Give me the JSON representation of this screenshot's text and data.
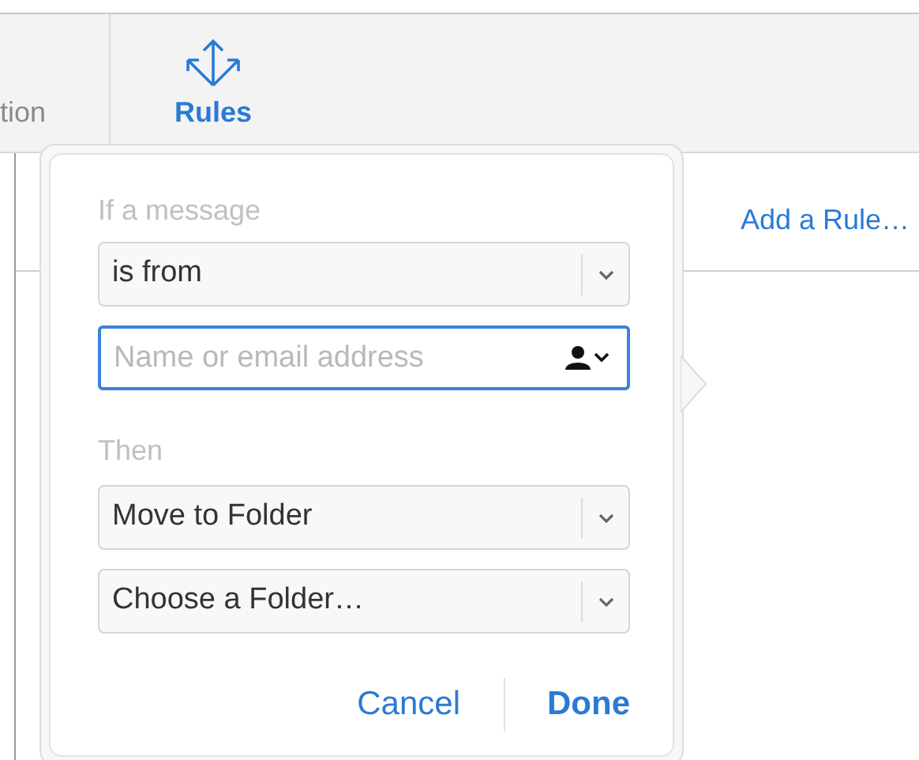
{
  "toolbar": {
    "items": [
      {
        "label": "tion",
        "selected": false
      },
      {
        "label": "Rules",
        "selected": true
      }
    ]
  },
  "add_rule_link": "Add a Rule…",
  "popover": {
    "condition_label": "If a message",
    "condition_select": "is from",
    "address_field": {
      "placeholder": "Name or email address",
      "focused": true
    },
    "action_label": "Then",
    "action_select": "Move to Folder",
    "folder_select": "Choose a Folder…",
    "buttons": [
      {
        "label": "Cancel",
        "primary": false
      },
      {
        "label": "Done",
        "primary": true
      }
    ]
  }
}
